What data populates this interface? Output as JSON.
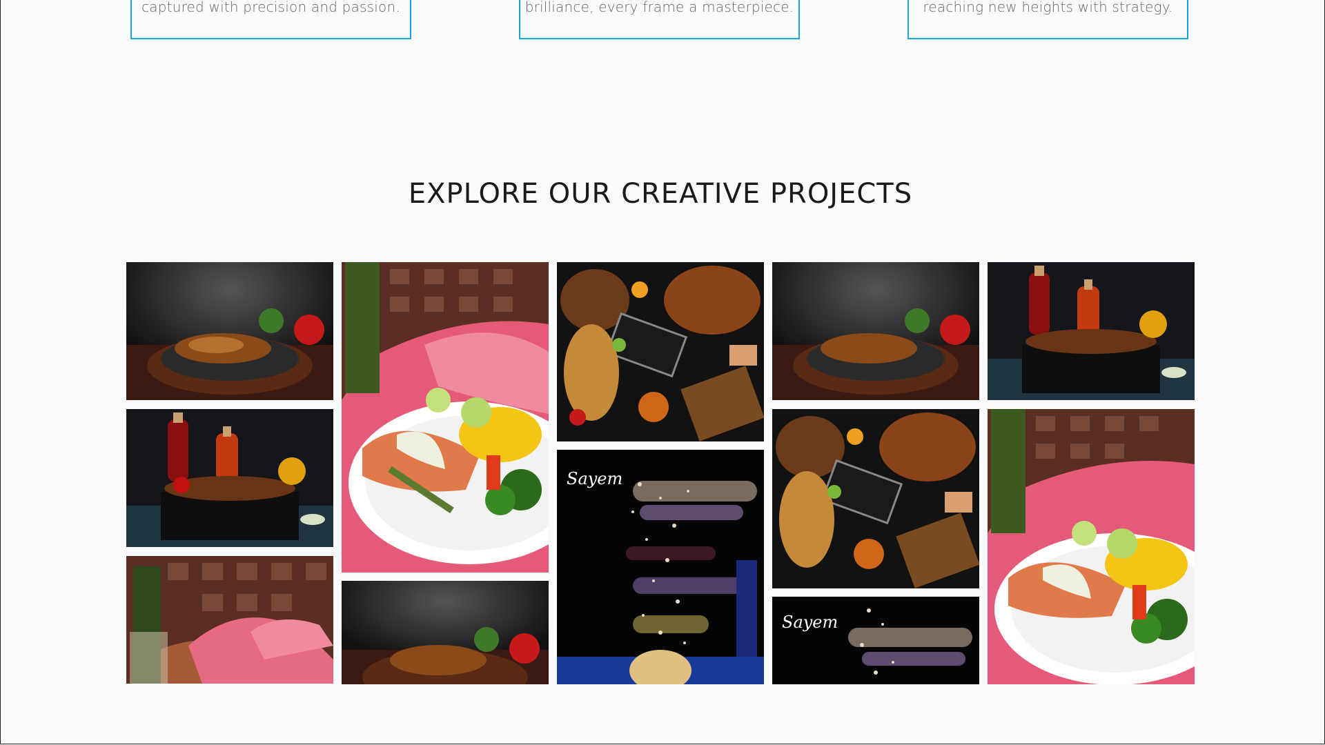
{
  "features": [
    {
      "desc": "captured with precision and passion."
    },
    {
      "desc": "brilliance, every frame a masterpiece."
    },
    {
      "desc": "reaching new heights with strategy."
    }
  ],
  "projects": {
    "title": "EXPLORE OUR CREATIVE PROJECTS",
    "watermark": "Sayem"
  },
  "colors": {
    "accent": "#1aa3e0",
    "background": "#fafafa",
    "title": "#1a1a1a"
  }
}
